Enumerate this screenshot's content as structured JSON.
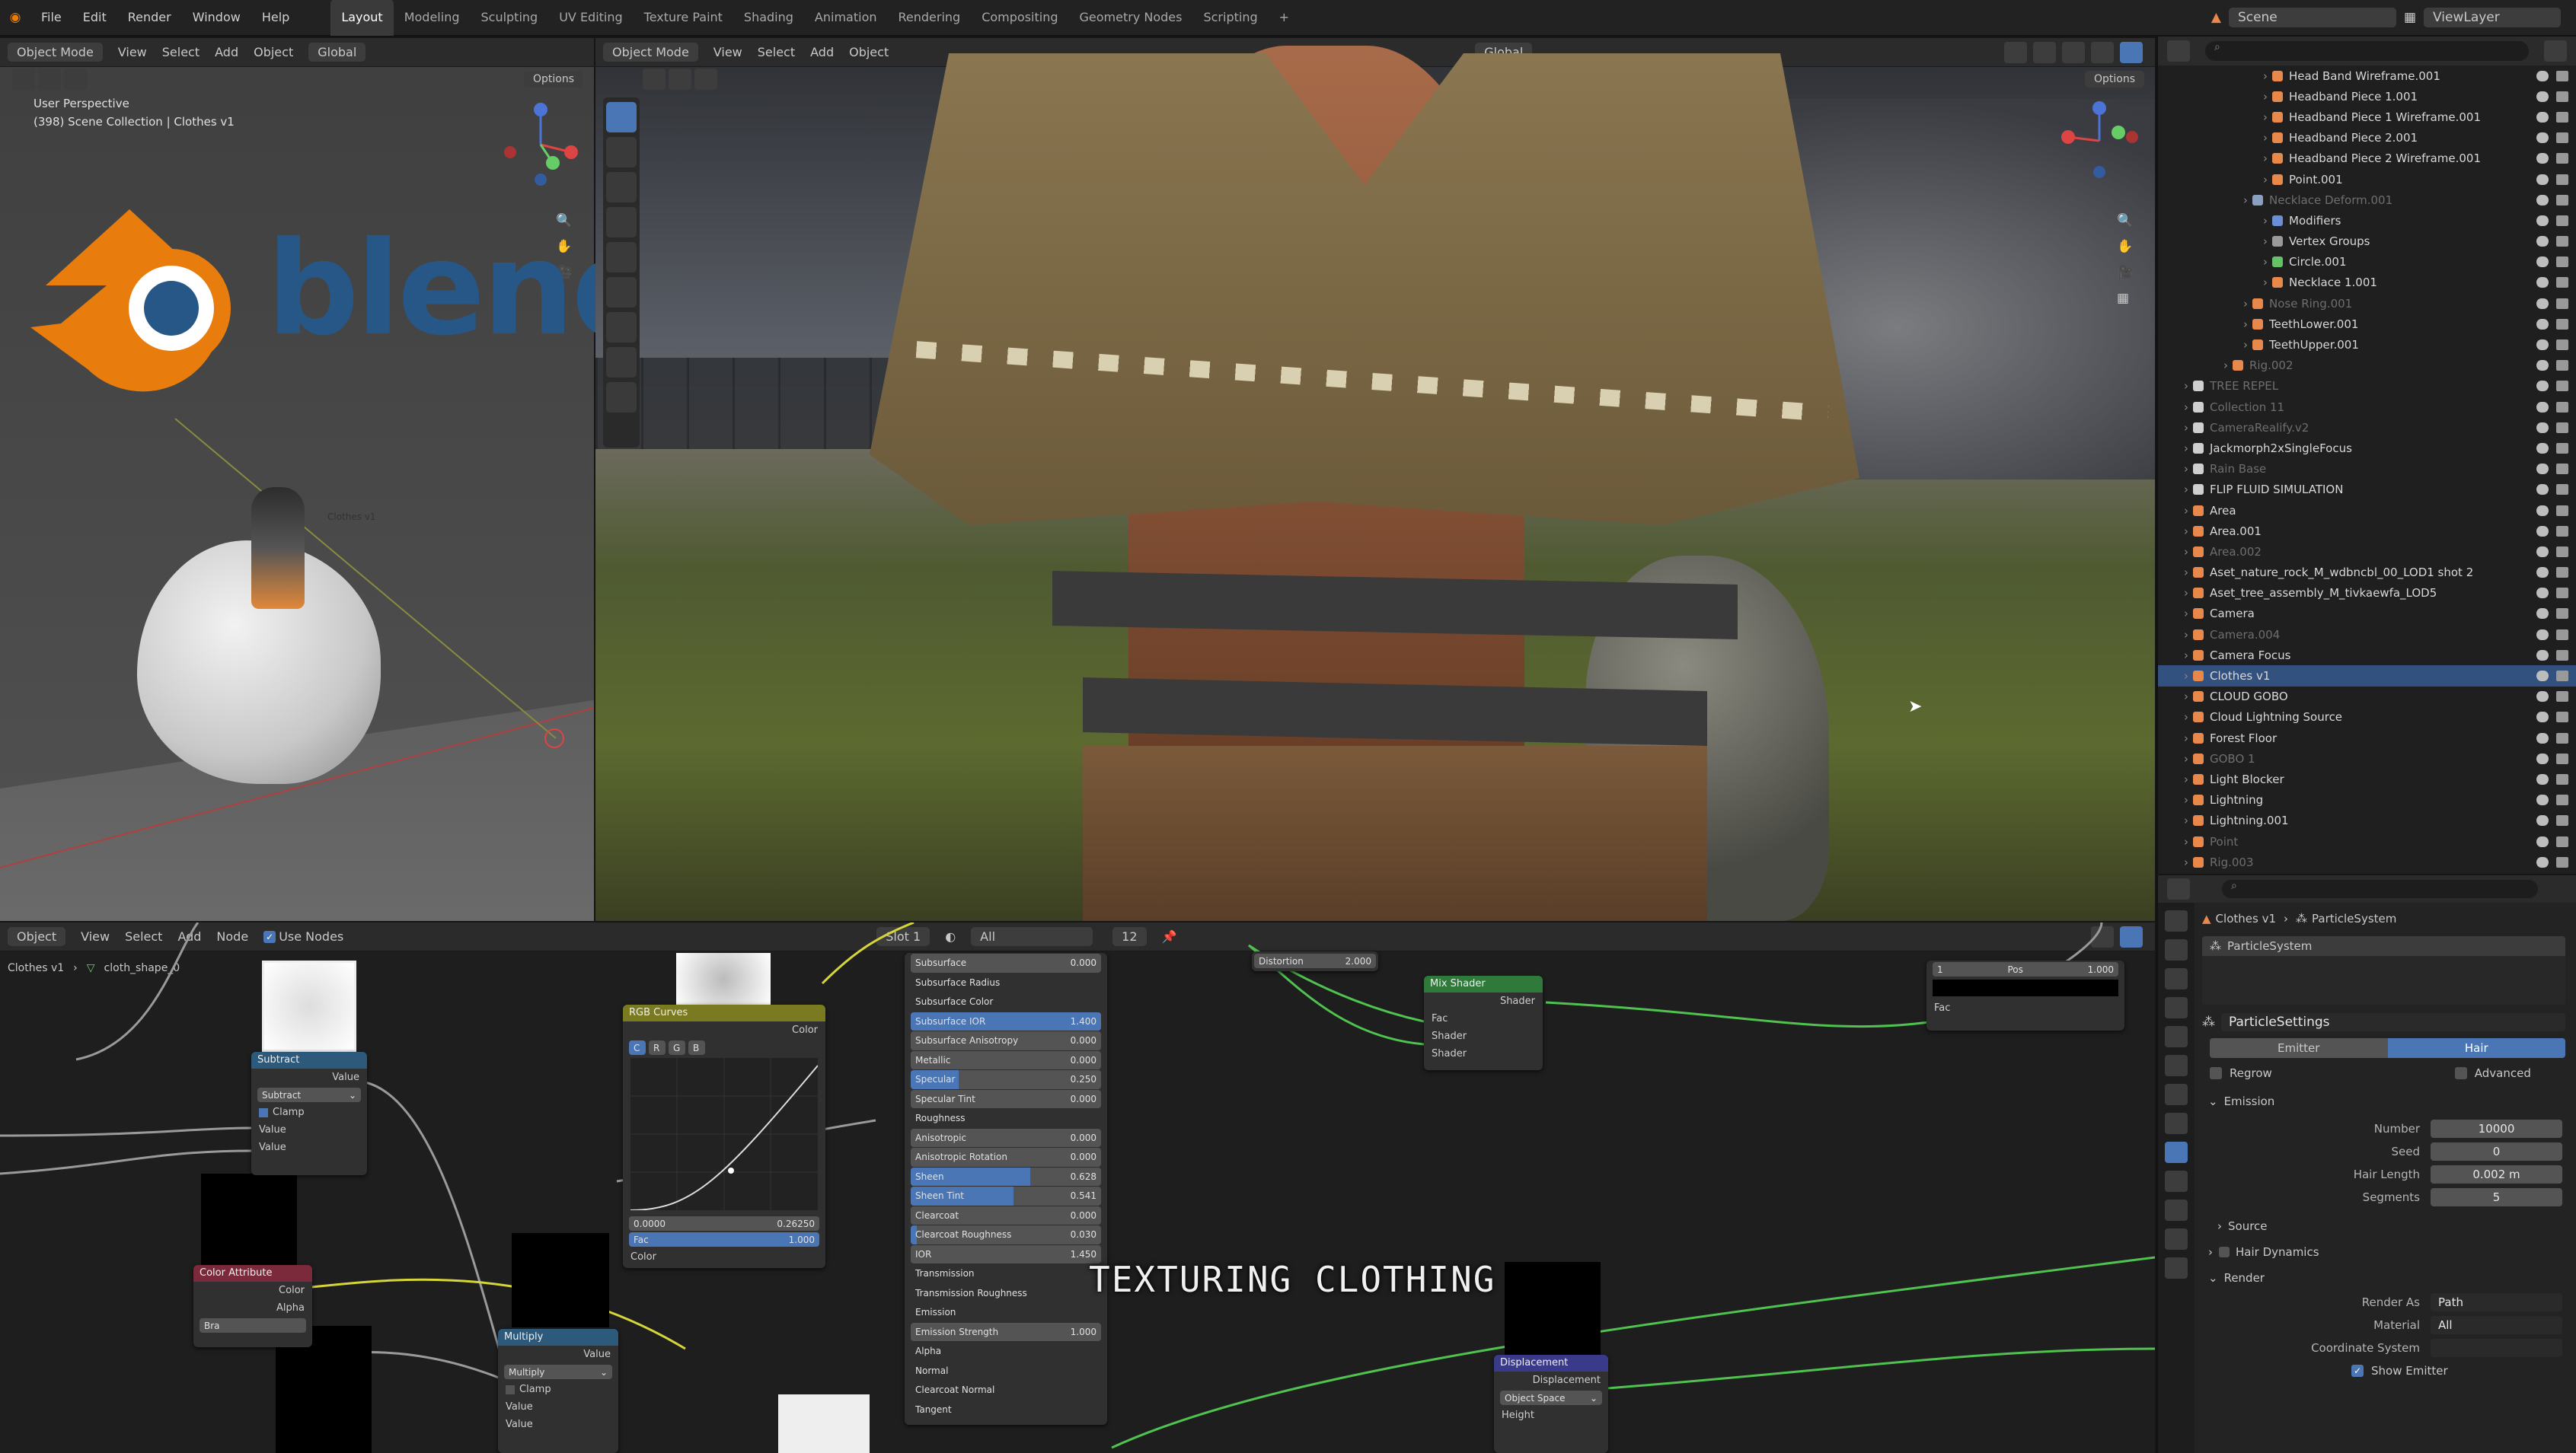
{
  "topbar": {
    "menus": [
      "File",
      "Edit",
      "Render",
      "Window",
      "Help"
    ],
    "workspaces": [
      "Layout",
      "Modeling",
      "Sculpting",
      "UV Editing",
      "Texture Paint",
      "Shading",
      "Animation",
      "Rendering",
      "Compositing",
      "Geometry Nodes",
      "Scripting"
    ],
    "active_workspace": "Layout",
    "scene_label": "Scene",
    "view_layer_label": "ViewLayer"
  },
  "left_viewport": {
    "mode": "Object Mode",
    "menus": [
      "View",
      "Select",
      "Add",
      "Object"
    ],
    "orientation": "Global",
    "options_label": "Options",
    "perspective": "User Perspective",
    "collection_info": "(398) Scene Collection | Clothes v1",
    "object_label": "Clothes v1"
  },
  "logo": {
    "text": "blender",
    "brand_orange": "#e87d0d",
    "brand_blue": "#265787"
  },
  "main_viewport": {
    "mode": "Object Mode",
    "menus": [
      "View",
      "Select",
      "Add",
      "Object"
    ],
    "orientation": "Global",
    "options_label": "Options"
  },
  "outliner": {
    "search_placeholder": "",
    "items": [
      {
        "name": "Head Band Wireframe.001",
        "indent": 5,
        "icon_color": "#e8884a",
        "dim": false
      },
      {
        "name": "Headband Piece 1.001",
        "indent": 5,
        "icon_color": "#e8884a",
        "dim": false
      },
      {
        "name": "Headband Piece 1 Wireframe.001",
        "indent": 5,
        "icon_color": "#e8884a",
        "dim": false
      },
      {
        "name": "Headband Piece 2.001",
        "indent": 5,
        "icon_color": "#e8884a",
        "dim": false
      },
      {
        "name": "Headband Piece 2 Wireframe.001",
        "indent": 5,
        "icon_color": "#e8884a",
        "dim": false
      },
      {
        "name": "Point.001",
        "indent": 5,
        "icon_color": "#e8884a",
        "dim": false
      },
      {
        "name": "Necklace Deform.001",
        "indent": 4,
        "icon_color": "#8aa0c0",
        "dim": true
      },
      {
        "name": "Modifiers",
        "indent": 5,
        "icon_color": "#6b8fd6",
        "dim": false
      },
      {
        "name": "Vertex Groups",
        "indent": 5,
        "icon_color": "#9a9a9a",
        "dim": false
      },
      {
        "name": "Circle.001",
        "indent": 5,
        "icon_color": "#66c266",
        "dim": false
      },
      {
        "name": "Necklace 1.001",
        "indent": 5,
        "icon_color": "#e8884a",
        "dim": false
      },
      {
        "name": "Nose Ring.001",
        "indent": 4,
        "icon_color": "#e8884a",
        "dim": true
      },
      {
        "name": "TeethLower.001",
        "indent": 4,
        "icon_color": "#e8884a",
        "dim": false
      },
      {
        "name": "TeethUpper.001",
        "indent": 4,
        "icon_color": "#e8884a",
        "dim": false
      },
      {
        "name": "Rig.002",
        "indent": 3,
        "icon_color": "#e8884a",
        "dim": true
      },
      {
        "name": "TREE REPEL",
        "indent": 1,
        "icon_color": "#cfcfcf",
        "dim": true
      },
      {
        "name": "Collection 11",
        "indent": 1,
        "icon_color": "#cfcfcf",
        "dim": true
      },
      {
        "name": "CameraRealify.v2",
        "indent": 1,
        "icon_color": "#cfcfcf",
        "dim": true
      },
      {
        "name": "Jackmorph2xSingleFocus",
        "indent": 1,
        "icon_color": "#cfcfcf",
        "dim": false
      },
      {
        "name": "Rain Base",
        "indent": 1,
        "icon_color": "#cfcfcf",
        "dim": true
      },
      {
        "name": "FLIP FLUID SIMULATION",
        "indent": 1,
        "icon_color": "#cfcfcf",
        "dim": false
      },
      {
        "name": "Area",
        "indent": 1,
        "icon_color": "#e8884a",
        "dim": false
      },
      {
        "name": "Area.001",
        "indent": 1,
        "icon_color": "#e8884a",
        "dim": false
      },
      {
        "name": "Area.002",
        "indent": 1,
        "icon_color": "#e8884a",
        "dim": true
      },
      {
        "name": "Aset_nature_rock_M_wdbncbl_00_LOD1 shot 2",
        "indent": 1,
        "icon_color": "#e8884a",
        "dim": false
      },
      {
        "name": "Aset_tree_assembly_M_tivkaewfa_LOD5",
        "indent": 1,
        "icon_color": "#e8884a",
        "dim": false
      },
      {
        "name": "Camera",
        "indent": 1,
        "icon_color": "#e8884a",
        "dim": false
      },
      {
        "name": "Camera.004",
        "indent": 1,
        "icon_color": "#e8884a",
        "dim": true
      },
      {
        "name": "Camera Focus",
        "indent": 1,
        "icon_color": "#e8884a",
        "dim": false
      },
      {
        "name": "Clothes v1",
        "indent": 1,
        "icon_color": "#e8884a",
        "dim": false,
        "selected": true
      },
      {
        "name": "CLOUD GOBO",
        "indent": 1,
        "icon_color": "#e8884a",
        "dim": false
      },
      {
        "name": "Cloud Lightning Source",
        "indent": 1,
        "icon_color": "#e8884a",
        "dim": false
      },
      {
        "name": "Forest Floor",
        "indent": 1,
        "icon_color": "#e8884a",
        "dim": false
      },
      {
        "name": "GOBO 1",
        "indent": 1,
        "icon_color": "#e8884a",
        "dim": true
      },
      {
        "name": "Light Blocker",
        "indent": 1,
        "icon_color": "#e8884a",
        "dim": false
      },
      {
        "name": "Lightning",
        "indent": 1,
        "icon_color": "#e8884a",
        "dim": false
      },
      {
        "name": "Lightning.001",
        "indent": 1,
        "icon_color": "#e8884a",
        "dim": false
      },
      {
        "name": "Point",
        "indent": 1,
        "icon_color": "#e8884a",
        "dim": true
      },
      {
        "name": "Rig.003",
        "indent": 1,
        "icon_color": "#e8884a",
        "dim": true
      }
    ]
  },
  "properties": {
    "breadcrumb": [
      "Clothes v1",
      "ParticleSystem"
    ],
    "system_name": "ParticleSystem",
    "settings_name": "ParticleSettings",
    "type_tabs": [
      "Emitter",
      "Hair"
    ],
    "active_type": "Hair",
    "regrow_label": "Regrow",
    "advanced_label": "Advanced",
    "emission_header": "Emission",
    "fields": [
      {
        "label": "Number",
        "value": "10000"
      },
      {
        "label": "Seed",
        "value": "0"
      },
      {
        "label": "Hair Length",
        "value": "0.002 m"
      },
      {
        "label": "Segments",
        "value": "5"
      }
    ],
    "source_header": "Source",
    "hair_dynamics_header": "Hair Dynamics",
    "render_header": "Render",
    "render_fields": [
      {
        "label": "Render As",
        "value": "Path"
      },
      {
        "label": "Material",
        "value": "All"
      },
      {
        "label": "Coordinate System",
        "value": ""
      }
    ],
    "show_emitter_label": "Show Emitter"
  },
  "node_editor": {
    "header_object": "Object",
    "menus": [
      "View",
      "Select",
      "Add",
      "Node"
    ],
    "use_nodes_label": "Use Nodes",
    "slot": "Slot 1",
    "material_filter": "All",
    "users_count": "12",
    "breadcrumb": [
      "Clothes v1",
      "cloth_shape_0"
    ],
    "overlay_title": "TEXTURING CLOTHING",
    "nodes": {
      "subtract": {
        "title": "Subtract",
        "value_label": "Value",
        "op": "Subtract",
        "clamp": "Clamp",
        "in1": "Value",
        "in2": "Value"
      },
      "rgb_curves": {
        "title": "RGB Curves",
        "color_label": "Color",
        "channels": [
          "C",
          "R",
          "G",
          "B"
        ],
        "x_val": "0.0000",
        "y_val": "0.26250",
        "fac": "Fac",
        "fac_val": "1.000",
        "color_in": "Color"
      },
      "color_attribute": {
        "title": "Color Attribute",
        "color": "Color",
        "alpha": "Alpha",
        "name": "Bra"
      },
      "multiply": {
        "title": "Multiply",
        "value": "Value",
        "op": "Multiply",
        "clamp": "Clamp",
        "in1": "Value",
        "in2": "Value"
      },
      "bsdf_rows": [
        {
          "label": "Subsurface",
          "value": "0.000",
          "fill": 0
        },
        {
          "label": "Subsurface Radius",
          "value": "",
          "fill": 0
        },
        {
          "label": "Subsurface Color",
          "value": "",
          "fill": 0
        },
        {
          "label": "Subsurface IOR",
          "value": "1.400",
          "fill": 1
        },
        {
          "label": "Subsurface Anisotropy",
          "value": "0.000",
          "fill": 0
        },
        {
          "label": "Metallic",
          "value": "0.000",
          "fill": 0
        },
        {
          "label": "Specular",
          "value": "0.250",
          "fill": 0.25
        },
        {
          "label": "Specular Tint",
          "value": "0.000",
          "fill": 0
        },
        {
          "label": "Roughness",
          "value": "",
          "fill": 0
        },
        {
          "label": "Anisotropic",
          "value": "0.000",
          "fill": 0
        },
        {
          "label": "Anisotropic Rotation",
          "value": "0.000",
          "fill": 0
        },
        {
          "label": "Sheen",
          "value": "0.628",
          "fill": 0.628
        },
        {
          "label": "Sheen Tint",
          "value": "0.541",
          "fill": 0.541
        },
        {
          "label": "Clearcoat",
          "value": "0.000",
          "fill": 0
        },
        {
          "label": "Clearcoat Roughness",
          "value": "0.030",
          "fill": 0.03
        },
        {
          "label": "IOR",
          "value": "1.450",
          "fill": 0
        },
        {
          "label": "Transmission",
          "value": "",
          "fill": 0
        },
        {
          "label": "Transmission Roughness",
          "value": "",
          "fill": 0
        },
        {
          "label": "Emission",
          "value": "",
          "fill": 0
        },
        {
          "label": "Emission Strength",
          "value": "1.000",
          "fill": 0
        },
        {
          "label": "Alpha",
          "value": "",
          "fill": 0
        },
        {
          "label": "Normal",
          "value": "",
          "fill": 0
        },
        {
          "label": "Clearcoat Normal",
          "value": "",
          "fill": 0
        },
        {
          "label": "Tangent",
          "value": "",
          "fill": 0
        }
      ],
      "distortion": {
        "label": "Distortion",
        "value": "2.000"
      },
      "mix_shader": {
        "title": "Mix Shader",
        "out": "Shader",
        "fac": "Fac",
        "s1": "Shader",
        "s2": "Shader"
      },
      "map_range": {
        "v1": "1",
        "label": "Pos",
        "v2": "1.000",
        "fac": "Fac"
      },
      "displacement": {
        "title": "Displacement",
        "out": "Displacement",
        "space": "Object Space",
        "height": "Height"
      }
    }
  }
}
